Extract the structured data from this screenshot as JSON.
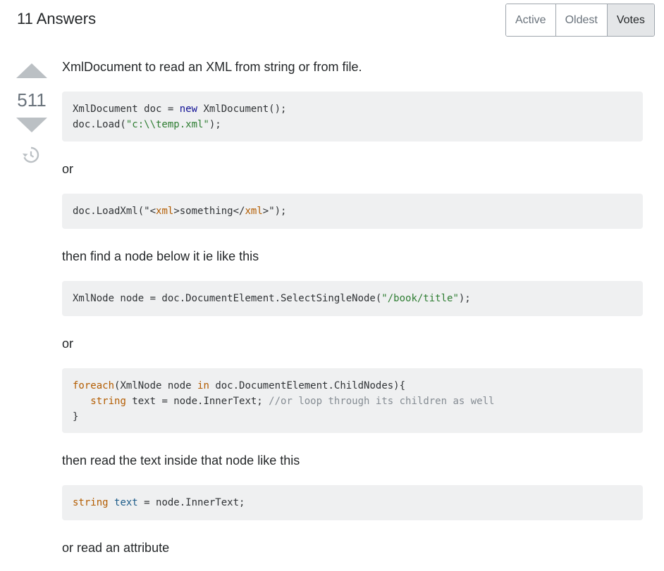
{
  "header": {
    "answers_count_label": "11 Answers"
  },
  "sort_tabs": [
    "Active",
    "Oldest",
    "Votes"
  ],
  "vote": {
    "count": "511"
  },
  "post": {
    "p1": "XmlDocument to read an XML from string or from file.",
    "code1": {
      "l1_a": "XmlDocument doc = ",
      "l1_kw": "new",
      "l1_b": " XmlDocument();",
      "l2_a": "doc.Load(",
      "l2_str": "\"c:\\\\temp.xml\"",
      "l2_b": ");"
    },
    "p2": "or",
    "code2": {
      "a": "doc.LoadXml(\"<",
      "tag1": "xml",
      "b": ">something</",
      "tag2": "xml",
      "c": ">\");"
    },
    "p3": "then find a node below it ie like this",
    "code3": {
      "a": "XmlNode node = doc.DocumentElement.SelectSingleNode(",
      "str": "\"/book/title\"",
      "b": ");"
    },
    "p4": "or",
    "code4": {
      "l1_kw": "foreach",
      "l1_a": "(XmlNode node ",
      "l1_kw2": "in",
      "l1_b": " doc.DocumentElement.ChildNodes){",
      "l2_indent": "   ",
      "l2_type": "string",
      "l2_a": " text = node.InnerText; ",
      "l2_cmt": "//or loop through its children as well",
      "l3": "}"
    },
    "p5": "then read the text inside that node like this",
    "code5": {
      "type": "string",
      "sp": " ",
      "var": "text",
      "rest": " = node.InnerText;"
    },
    "p6": "or read an attribute"
  },
  "icons": {
    "vote_up": "triangle-up-icon",
    "vote_down": "triangle-down-icon",
    "history": "history-clock-icon"
  },
  "colors": {
    "code_bg": "#eff0f1",
    "vote_arrow": "#bbc0c4",
    "active_tab_bg": "#e4e6e8"
  }
}
